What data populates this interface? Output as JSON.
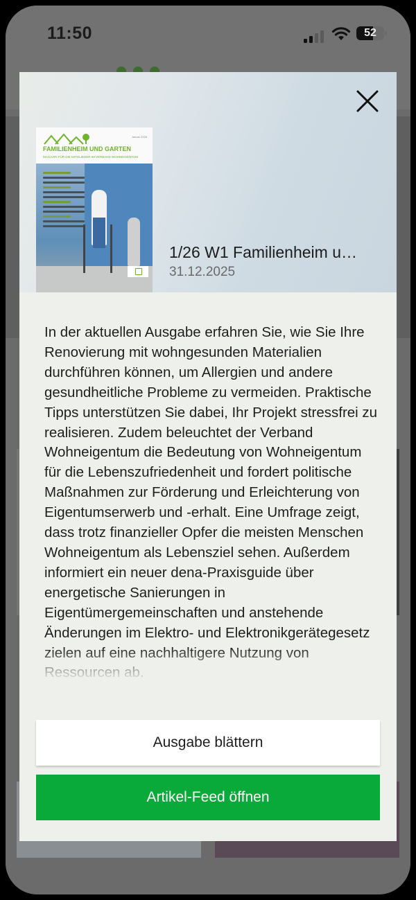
{
  "status_bar": {
    "time": "11:50",
    "battery_level": "52",
    "signal_icon": "cellular-signal-icon",
    "wifi_icon": "wifi-icon",
    "battery_icon": "battery-icon"
  },
  "modal": {
    "close_icon": "close-icon",
    "cover": {
      "masthead": "FAMILIENHEIM UND GARTEN",
      "tagline": "MAGAZIN FÜR DIE MITGLIEDER IM VERBAND WOHNEIGENTUM",
      "edition": "Januar 2026"
    },
    "issue_title": "1/26 W1 Familienheim u…",
    "issue_date": "31.12.2025",
    "description": "In der aktuellen Ausgabe erfahren Sie, wie Sie Ihre Renovierung mit wohngesunden Materialien durchführen können, um Allergien und andere gesundheitliche Probleme zu vermeiden. Praktische Tipps unterstützen Sie dabei, Ihr Projekt stressfrei zu realisieren. Zudem beleuchtet der Verband Wohneigentum die Bedeutung von Wohneigentum für die Lebenszufriedenheit und fordert politische Maßnahmen zur Förderung und Erleichterung von Eigentumserwerb und -erhalt. Eine Umfrage zeigt, dass trotz finanzieller Opfer die meisten Menschen Wohneigentum als Lebensziel sehen. Außerdem informiert ein neuer dena-Praxisguide über energetische Sanierungen in Eigentümergemeinschaften und anstehende Änderungen im Elektro- und Elektronikgerätegesetz zielen auf eine nachhaltigere Nutzung von Ressourcen ab.",
    "buttons": {
      "browse_label": "Ausgabe blättern",
      "feed_label": "Artikel-Feed öffnen"
    }
  },
  "colors": {
    "accent_green": "#0aaa3a",
    "modal_background": "#eef0ec",
    "cover_green": "#6fb22c"
  }
}
